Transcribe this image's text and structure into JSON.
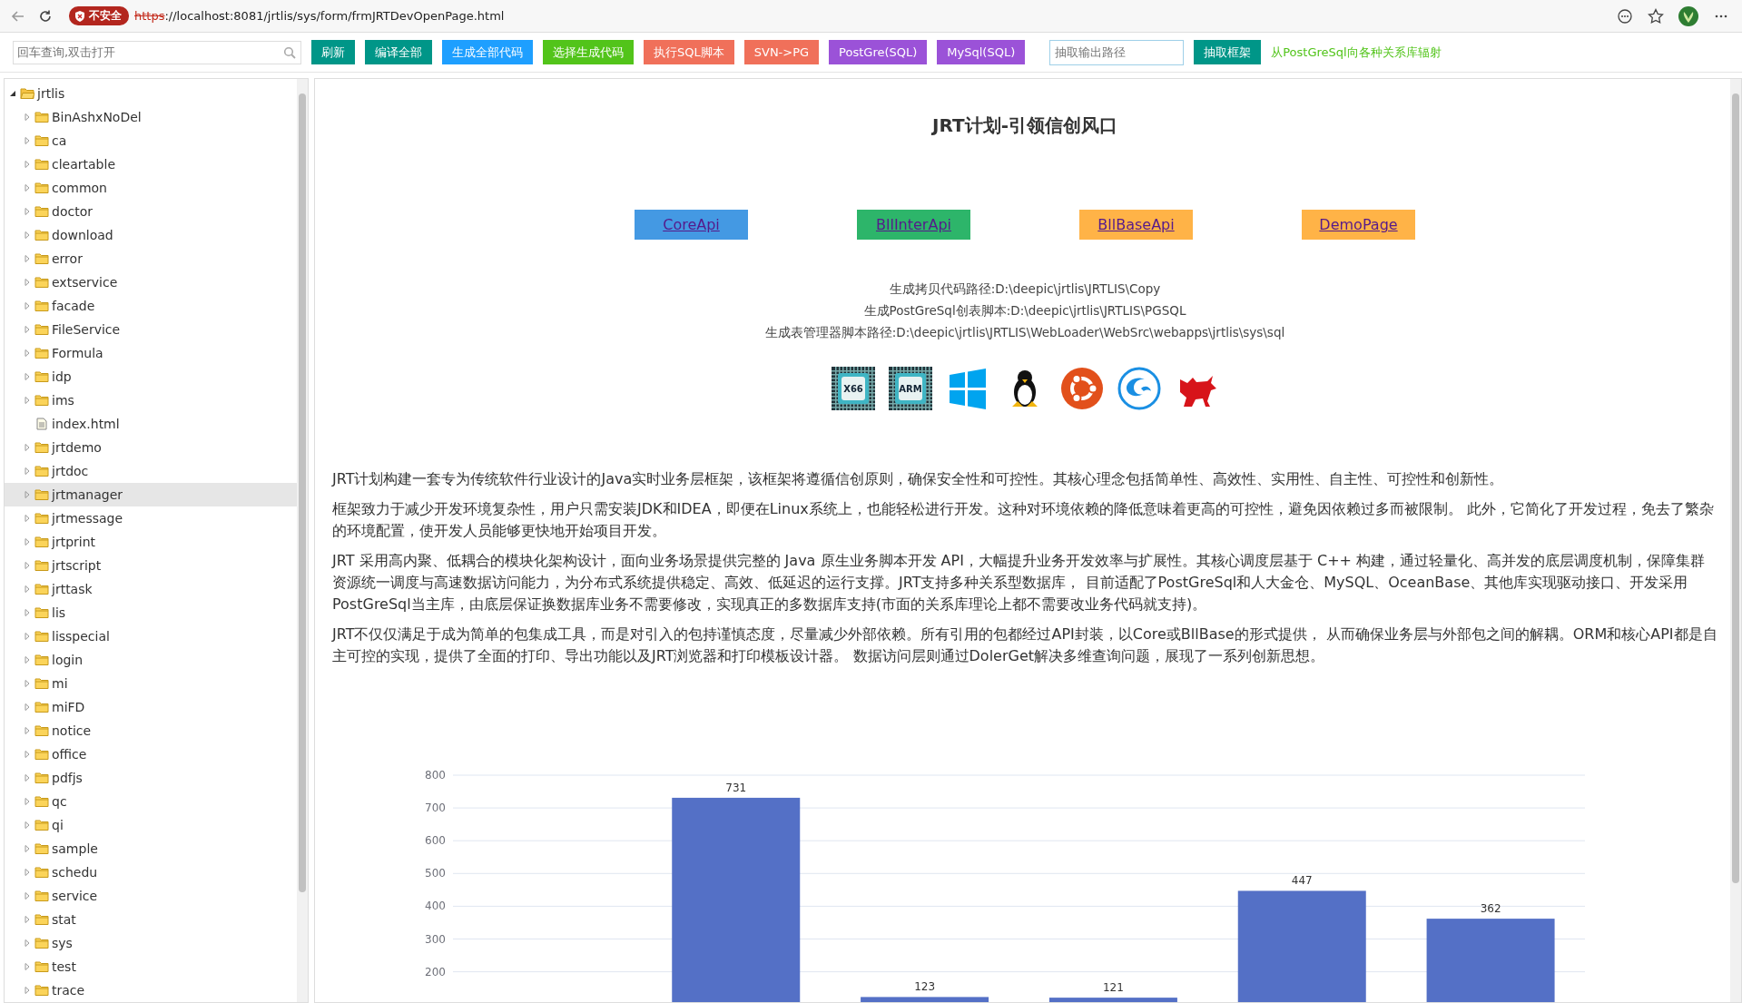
{
  "browser": {
    "security_label": "不安全",
    "url_scheme": "https",
    "url_rest": "://localhost:8081/jrtlis/sys/form/frmJRTDevOpenPage.html"
  },
  "toolbar": {
    "search": {
      "placeholder": "回车查询,双击打开"
    },
    "buttons": [
      {
        "label": "刷新",
        "color": "#009688"
      },
      {
        "label": "编译全部",
        "color": "#009688"
      },
      {
        "label": "生成全部代码",
        "color": "#1e9fff"
      },
      {
        "label": "选择生成代码",
        "color": "#52c41a"
      },
      {
        "label": "执行SQL脚本",
        "color": "#f0705a"
      },
      {
        "label": "SVN->PG",
        "color": "#f0705a"
      },
      {
        "label": "PostGre(SQL)",
        "color": "#9b52d8"
      },
      {
        "label": "MySql(SQL)",
        "color": "#9b52d8"
      }
    ],
    "path_field": {
      "placeholder": "抽取输出路径"
    },
    "extract_button": {
      "label": "抽取框架",
      "color": "#009688"
    },
    "link": "从PostGreSql向各种关系库辐射"
  },
  "tree": {
    "label": "jrtlis",
    "expanded": true,
    "children": [
      {
        "label": "BinAshxNoDel",
        "kind": "folder",
        "expanded": false,
        "selected": false
      },
      {
        "label": "ca",
        "kind": "folder",
        "expanded": false,
        "selected": false
      },
      {
        "label": "cleartable",
        "kind": "folder",
        "expanded": false,
        "selected": false
      },
      {
        "label": "common",
        "kind": "folder",
        "expanded": false,
        "selected": false
      },
      {
        "label": "doctor",
        "kind": "folder",
        "expanded": false,
        "selected": false
      },
      {
        "label": "download",
        "kind": "folder",
        "expanded": false,
        "selected": false
      },
      {
        "label": "error",
        "kind": "folder",
        "expanded": false,
        "selected": false
      },
      {
        "label": "extservice",
        "kind": "folder",
        "expanded": false,
        "selected": false
      },
      {
        "label": "facade",
        "kind": "folder",
        "expanded": false,
        "selected": false
      },
      {
        "label": "FileService",
        "kind": "folder",
        "expanded": false,
        "selected": false
      },
      {
        "label": "Formula",
        "kind": "folder",
        "expanded": false,
        "selected": false
      },
      {
        "label": "idp",
        "kind": "folder",
        "expanded": false,
        "selected": false
      },
      {
        "label": "ims",
        "kind": "folder",
        "expanded": false,
        "selected": false
      },
      {
        "label": "index.html",
        "kind": "file",
        "selected": false
      },
      {
        "label": "jrtdemo",
        "kind": "folder",
        "expanded": false,
        "selected": false
      },
      {
        "label": "jrtdoc",
        "kind": "folder",
        "expanded": false,
        "selected": false
      },
      {
        "label": "jrtmanager",
        "kind": "folder",
        "expanded": false,
        "selected": true
      },
      {
        "label": "jrtmessage",
        "kind": "folder",
        "expanded": false,
        "selected": false
      },
      {
        "label": "jrtprint",
        "kind": "folder",
        "expanded": false,
        "selected": false
      },
      {
        "label": "jrtscript",
        "kind": "folder",
        "expanded": false,
        "selected": false
      },
      {
        "label": "jrttask",
        "kind": "folder",
        "expanded": false,
        "selected": false
      },
      {
        "label": "lis",
        "kind": "folder",
        "expanded": false,
        "selected": false
      },
      {
        "label": "lisspecial",
        "kind": "folder",
        "expanded": false,
        "selected": false
      },
      {
        "label": "login",
        "kind": "folder",
        "expanded": false,
        "selected": false
      },
      {
        "label": "mi",
        "kind": "folder",
        "expanded": false,
        "selected": false
      },
      {
        "label": "miFD",
        "kind": "folder",
        "expanded": false,
        "selected": false
      },
      {
        "label": "notice",
        "kind": "folder",
        "expanded": false,
        "selected": false
      },
      {
        "label": "office",
        "kind": "folder",
        "expanded": false,
        "selected": false
      },
      {
        "label": "pdfjs",
        "kind": "folder",
        "expanded": false,
        "selected": false
      },
      {
        "label": "qc",
        "kind": "folder",
        "expanded": false,
        "selected": false
      },
      {
        "label": "qi",
        "kind": "folder",
        "expanded": false,
        "selected": false
      },
      {
        "label": "sample",
        "kind": "folder",
        "expanded": false,
        "selected": false
      },
      {
        "label": "schedu",
        "kind": "folder",
        "expanded": false,
        "selected": false
      },
      {
        "label": "service",
        "kind": "folder",
        "expanded": false,
        "selected": false
      },
      {
        "label": "stat",
        "kind": "folder",
        "expanded": false,
        "selected": false
      },
      {
        "label": "sys",
        "kind": "folder",
        "expanded": false,
        "selected": false
      },
      {
        "label": "test",
        "kind": "folder",
        "expanded": false,
        "selected": false
      },
      {
        "label": "trace",
        "kind": "folder",
        "expanded": false,
        "selected": false
      }
    ]
  },
  "main": {
    "title": "JRT计划-引领信创风口",
    "links": [
      {
        "label": "CoreApi",
        "color": "#4499e3"
      },
      {
        "label": "BllInterApi",
        "color": "#2db56a"
      },
      {
        "label": "BllBaseApi",
        "color": "#ffb347"
      },
      {
        "label": "DemoPage",
        "color": "#ffb347"
      }
    ],
    "paths": [
      "生成拷贝代码路径:D:\\deepic\\jrtlis\\JRTLIS\\Copy",
      "生成PostGreSql创表脚本:D:\\deepic\\jrtlis\\JRTLIS\\PGSQL",
      "生成表管理器脚本路径:D:\\deepic\\jrtlis\\JRTLIS\\WebLoader\\WebSrc\\webapps\\jrtlis\\sys\\sql"
    ],
    "platform_icons": [
      {
        "kind": "chip",
        "label": "X66"
      },
      {
        "kind": "chip",
        "label": "ARM"
      },
      {
        "kind": "panes"
      },
      {
        "kind": "penguin"
      },
      {
        "kind": "ring"
      },
      {
        "kind": "swirl"
      },
      {
        "kind": "animal"
      }
    ],
    "paragraphs": [
      "JRT计划构建一套专为传统软件行业设计的Java实时业务层框架，该框架将遵循信创原则，确保安全性和可控性。其核心理念包括简单性、高效性、实用性、自主性、可控性和创新性。",
      "框架致力于减少开发环境复杂性，用户只需安装JDK和IDEA，即便在Linux系统上，也能轻松进行开发。这种对环境依赖的降低意味着更高的可控性，避免因依赖过多而被限制。 此外，它简化了开发过程，免去了繁杂的环境配置，使开发人员能够更快地开始项目开发。",
      "JRT 采用高内聚、低耦合的模块化架构设计，面向业务场景提供完整的 Java 原生业务脚本开发 API，大幅提升业务开发效率与扩展性。其核心调度层基于 C++ 构建，通过轻量化、高并发的底层调度机制，保障集群资源统一调度与高速数据访问能力，为分布式系统提供稳定、高效、低延迟的运行支撑。JRT支持多种关系型数据库， 目前适配了PostGreSql和人大金仓、MySQL、OceanBase、其他库实现驱动接口、开发采用PostGreSql当主库，由底层保证换数据库业务不需要修改，实现真正的多数据库支持(市面的关系库理论上都不需要改业务代码就支持)。",
      "JRT不仅仅满足于成为简单的包集成工具，而是对引入的包持谨慎态度，尽量减少外部依赖。所有引用的包都经过API封装，以Core或BllBase的形式提供， 从而确保业务层与外部包之间的解耦。ORM和核心API都是自主可控的实现，提供了全面的打印、导出功能以及JRT浏览器和打印模板设计器。 数据访问层则通过DolerGet解决多维查询问题，展现了一系列创新思想。"
    ],
    "chart_data": {
      "type": "bar",
      "values": [
        null,
        731,
        123,
        121,
        447,
        362
      ],
      "ylim": [
        0,
        800
      ],
      "yticks": [
        200,
        300,
        400,
        500,
        600,
        700,
        800
      ],
      "grid": true,
      "data_labels": true
    }
  }
}
